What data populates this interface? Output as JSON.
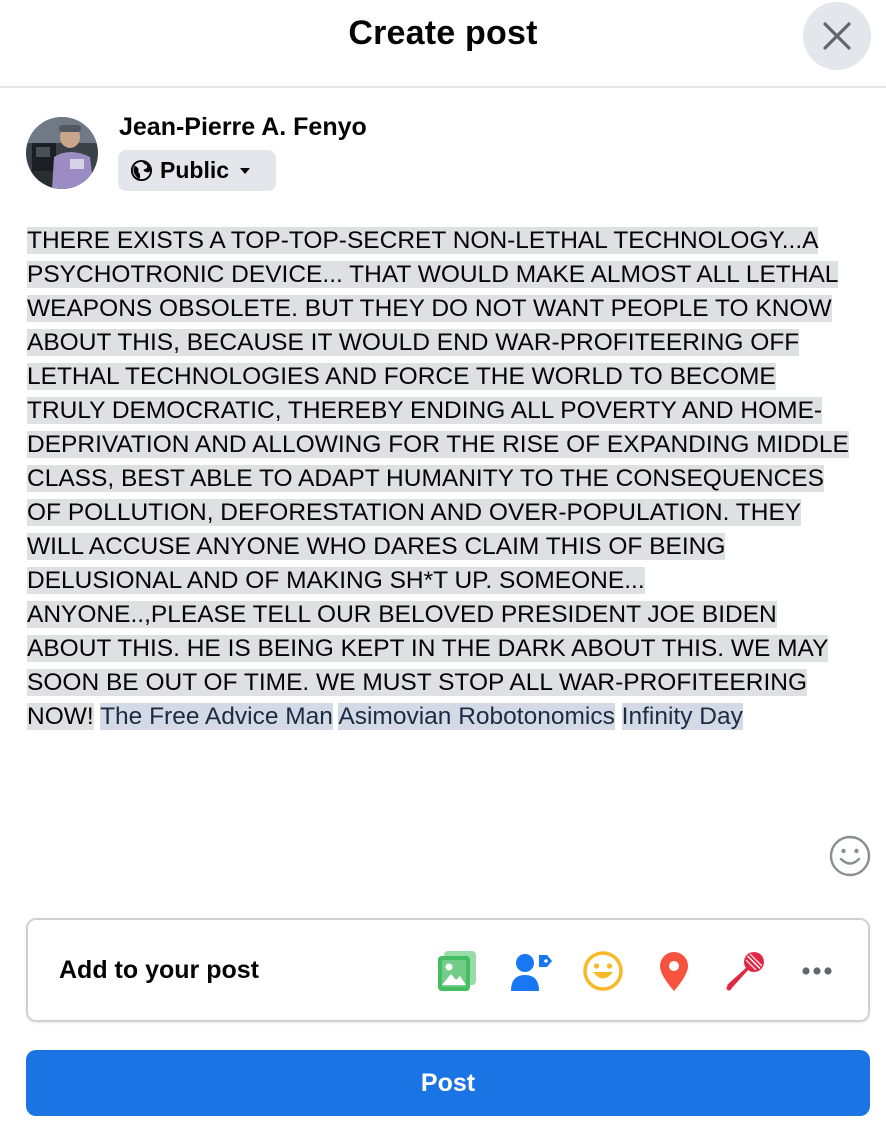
{
  "header": {
    "title": "Create post"
  },
  "author": {
    "name": "Jean-Pierre A. Fenyo",
    "audience": "Public"
  },
  "post": {
    "text": "THERE EXISTS A TOP-TOP-SECRET NON-LETHAL TECHNOLOGY...A PSYCHOTRONIC DEVICE... THAT WOULD MAKE ALMOST ALL LETHAL WEAPONS OBSOLETE. BUT THEY DO NOT WANT PEOPLE TO KNOW ABOUT THIS, BECAUSE IT WOULD END WAR-PROFITEERING OFF LETHAL TECHNOLOGIES AND FORCE THE WORLD TO BECOME TRULY DEMOCRATIC, THEREBY ENDING ALL POVERTY AND HOME-DEPRIVATION AND ALLOWING FOR THE RISE OF EXPANDING MIDDLE CLASS, BEST ABLE TO ADAPT HUMANITY TO THE CONSEQUENCES OF POLLUTION, DEFORESTATION AND OVER-POPULATION. THEY WILL ACCUSE ANYONE WHO DARES CLAIM THIS OF BEING DELUSIONAL AND OF MAKING SH*T UP. SOMEONE... ANYONE..,PLEASE TELL OUR BELOVED PRESIDENT JOE BIDEN ABOUT THIS. HE IS BEING KEPT IN THE DARK ABOUT THIS.  WE MAY SOON BE OUT OF TIME. WE MUST STOP ALL WAR-PROFITEERING NOW!",
    "tags": [
      "The Free Advice Man",
      "Asimovian Robotonomics",
      "Infinity Day"
    ]
  },
  "add_to_post": {
    "label": "Add to your post",
    "icons": [
      "photo-video-icon",
      "tag-people-icon",
      "feeling-activity-icon",
      "check-in-icon",
      "host-qa-icon",
      "more-icon"
    ]
  },
  "colors": {
    "primary": "#1b74e4",
    "photo": "#45bd62",
    "tag": "#1877f2",
    "feeling": "#f7b928",
    "checkin": "#f5533d",
    "mic": "#e42645",
    "text_highlight": "#dfe0e2",
    "tag_highlight": "#d3dae6"
  },
  "actions": {
    "post_label": "Post"
  }
}
